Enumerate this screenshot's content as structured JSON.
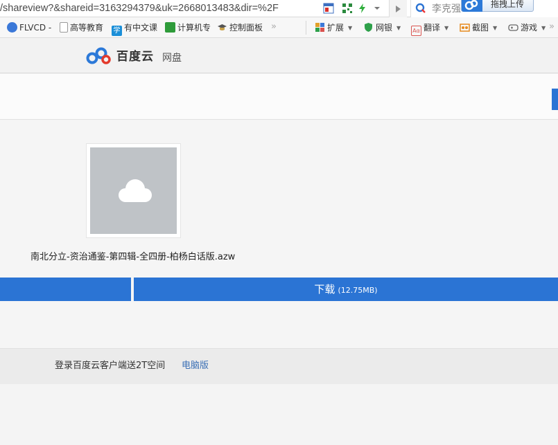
{
  "browser": {
    "url": "/shareview?&shareid=3163294379&uk=2668013483&dir=%2F",
    "search_text": "李克强",
    "upload_label": "拖拽上传",
    "favorites": [
      {
        "label": "FLVCD -",
        "icon": "globe-icon",
        "color": "#3b78d8"
      },
      {
        "label": "高等教育",
        "icon": "page-icon",
        "color": "#ffffff"
      },
      {
        "label": "有中文课",
        "icon": "xue-icon",
        "color": "#1b8fd8"
      },
      {
        "label": "计算机专",
        "icon": "green-book-icon",
        "color": "#2e9b3a"
      },
      {
        "label": "控制面板",
        "icon": "graduation-cap-icon",
        "color": "#6b6b6b"
      }
    ],
    "more_symbol": "»",
    "tools": [
      {
        "label": "扩展",
        "icon": "extension-grid-icon",
        "color": "#e2a02a"
      },
      {
        "label": "网银",
        "icon": "shield-icon",
        "color": "#2ea04a"
      },
      {
        "label": "翻译",
        "icon": "translate-icon",
        "color": "#d9534f"
      },
      {
        "label": "截图",
        "icon": "scissors-icon",
        "color": "#e58a1f"
      },
      {
        "label": "游戏",
        "icon": "gamepad-icon",
        "color": "#666666"
      }
    ],
    "overflow_symbol": "»"
  },
  "header": {
    "logo_text": "百度云",
    "logo_sub": "网盘"
  },
  "file": {
    "name": "南北分立-资治通鉴-第四辑-全四册-柏杨白话版.azw",
    "download_label": "下载",
    "download_size": "(12.75MB)"
  },
  "footer": {
    "promo": "登录百度云客户端送2T空间",
    "pc_link": "电脑版"
  },
  "colors": {
    "accent_blue": "#2b74d4",
    "thumb_gray": "#bfc3c7",
    "link_blue": "#3a6fb5"
  }
}
